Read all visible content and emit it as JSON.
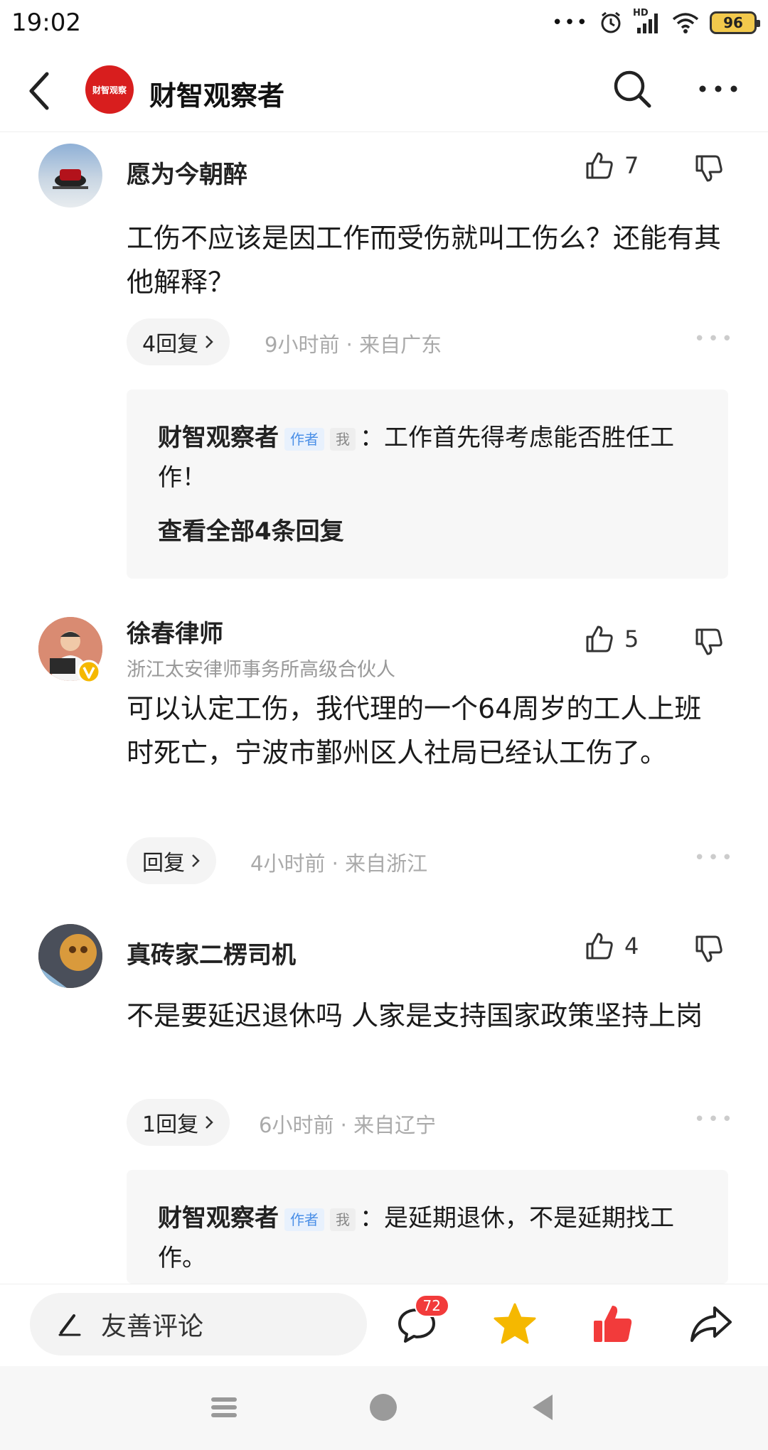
{
  "status_bar": {
    "time": "19:02",
    "battery": "96",
    "hd_label": "HD"
  },
  "header": {
    "title": "财智观察者",
    "logo_text": "财智观察"
  },
  "comments": [
    {
      "username": "愿为今朝醉",
      "likes": "7",
      "text": "工伤不应该是因工作而受伤就叫工伤么？还能有其他解释？",
      "reply_label": "4回复",
      "meta": "9小时前 · 来自广东",
      "reply": {
        "name": "财智观察者",
        "author_tag": "作者",
        "me_tag": "我",
        "text": "：工作首先得考虑能否胜任工作！",
        "view_all": "查看全部4条回复"
      }
    },
    {
      "username": "徐春律师",
      "subtitle": "浙江太安律师事务所高级合伙人",
      "likes": "5",
      "text": "可以认定工伤，我代理的一个64周岁的工人上班时死亡，宁波市鄞州区人社局已经认工伤了。",
      "reply_label": "回复",
      "meta": "4小时前 · 来自浙江"
    },
    {
      "username": "真砖家二楞司机",
      "likes": "4",
      "text": "不是要延迟退休吗 人家是支持国家政策坚持上岗",
      "reply_label": "1回复",
      "meta": "6小时前 · 来自辽宁",
      "reply": {
        "name": "财智观察者",
        "author_tag": "作者",
        "me_tag": "我",
        "text": "：是延期退休，不是延期找工作。"
      }
    }
  ],
  "bottom_bar": {
    "comment_placeholder": "友善评论",
    "comment_count": "72"
  },
  "colors": {
    "accent_red": "#f23b3b",
    "star_yellow": "#f5b800",
    "author_tag_blue": "#4a8fe7"
  }
}
